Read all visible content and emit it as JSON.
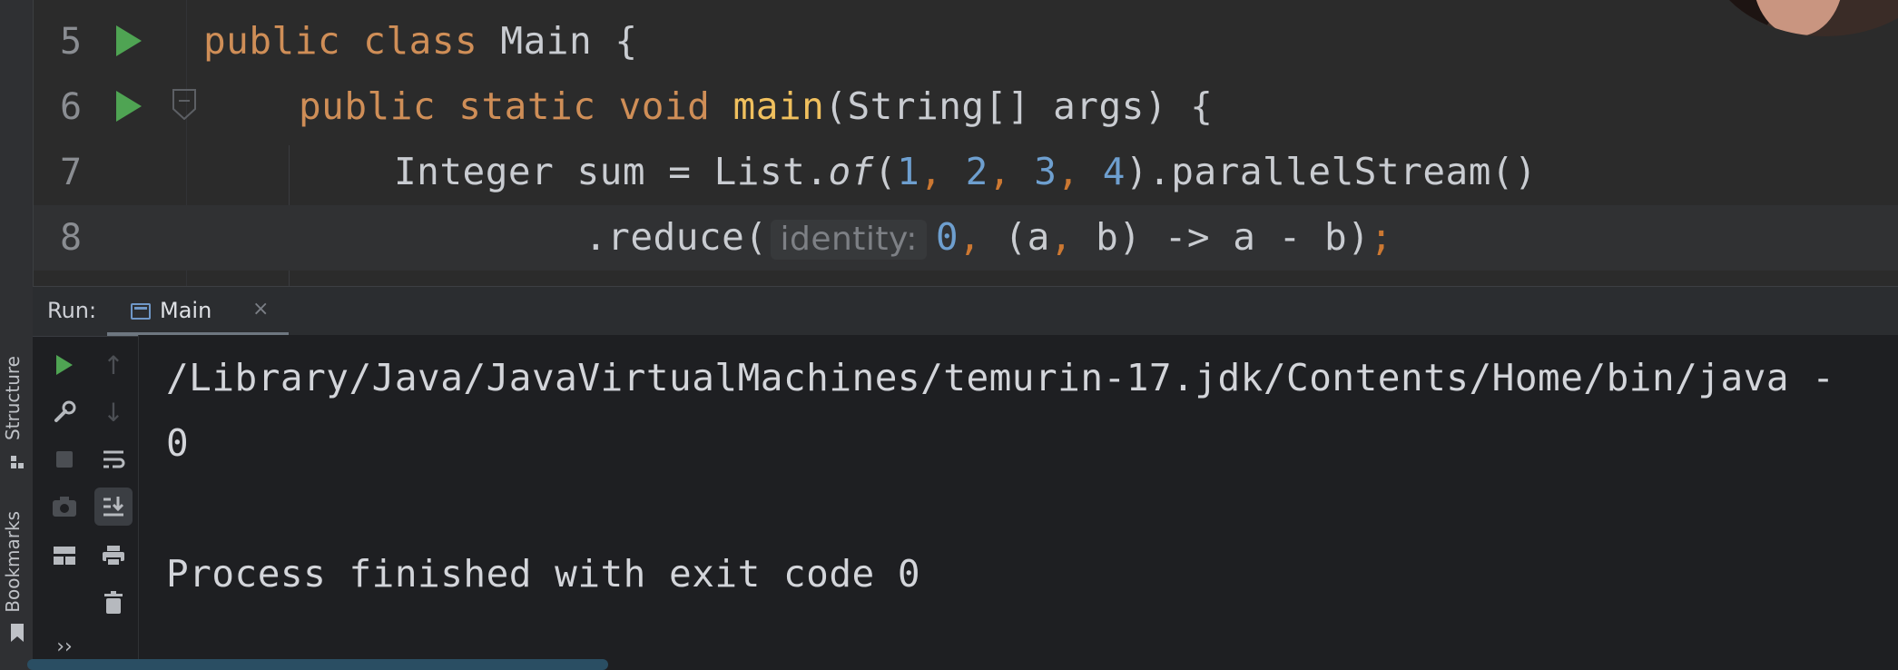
{
  "editor": {
    "lines": [
      {
        "number": "5",
        "run_gutter": true
      },
      {
        "number": "6",
        "run_gutter": true
      },
      {
        "number": "7",
        "run_gutter": false
      },
      {
        "number": "8",
        "run_gutter": false
      }
    ],
    "code": {
      "l5": {
        "kw1": "public",
        "kw2": "class",
        "name": "Main",
        "brace": "{"
      },
      "l6": {
        "kw1": "public",
        "kw2": "static",
        "kw3": "void",
        "method": "main",
        "params": "(String[] args) {"
      },
      "l7": {
        "type": "Integer sum = List.",
        "of": "of",
        "open": "(",
        "n1": "1",
        "c1": ",",
        "n2": "2",
        "c2": ",",
        "n3": "3",
        "c3": ",",
        "n4": "4",
        "close": ").parallelStream()"
      },
      "l8": {
        "call": ".reduce(",
        "hint": "identity:",
        "zero": "0",
        "comma": ",",
        "lambda": "(a",
        "comma2": ",",
        "rest": "b) -> a - b)",
        "semi": ";"
      }
    }
  },
  "run_panel": {
    "title": "Run:",
    "tab_label": "Main",
    "tab_close": "×",
    "console_lines": [
      "/Library/Java/JavaVirtualMachines/temurin-17.jdk/Contents/Home/bin/java -",
      "0",
      "",
      "Process finished with exit code 0"
    ],
    "more_toolbar": "››"
  },
  "side_tabs": {
    "structure": "Structure",
    "bookmarks": "Bookmarks"
  },
  "colors": {
    "keyword": "#cf8e57",
    "method": "#f0c05e",
    "number": "#6e9fcf",
    "run_green": "#4fa453",
    "background": "#1e1f22"
  }
}
